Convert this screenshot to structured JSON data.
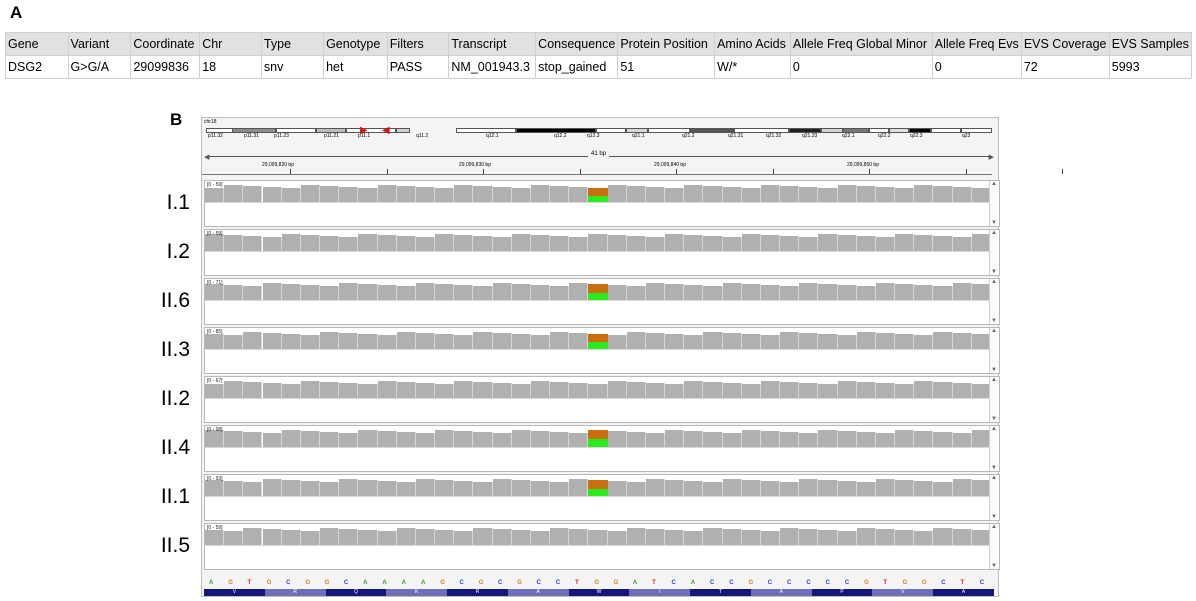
{
  "panel_a_label": "A",
  "panel_b_label": "B",
  "table": {
    "headers": [
      "Gene",
      "Variant",
      "Coordinate",
      "Chr",
      "Type",
      "Genotype",
      "Filters",
      "Transcript",
      "Consequence",
      "Protein Position",
      "Amino Acids",
      "Allele Freq Global Minor",
      "Allele Freq Evs",
      "EVS Coverage",
      "EVS Samples"
    ],
    "row": [
      "DSG2",
      "G>G/A",
      "29099836",
      "18",
      "snv",
      "het",
      "PASS",
      "NM_001943.3",
      "stop_gained",
      "51",
      "W/*",
      "0",
      "0",
      "72",
      "5993"
    ]
  },
  "igv": {
    "chromosome": "chr18",
    "bands": [
      "p11.32",
      "p11.31",
      "p11.23",
      "p11.21",
      "p11.1",
      "q11.2",
      "q12.1",
      "q12.2",
      "q12.3",
      "q21.1",
      "q21.2",
      "q21.31",
      "q21.32",
      "q21.33",
      "q22.1",
      "q22.2",
      "q22.3",
      "q23"
    ],
    "span_label": "41 bp",
    "ticks": [
      "29,099,820 bp",
      "29,099,830 bp",
      "29,099,840 bp",
      "29,099,850 bp"
    ],
    "sequence": [
      "A",
      "G",
      "T",
      "G",
      "C",
      "G",
      "G",
      "C",
      "A",
      "A",
      "A",
      "A",
      "G",
      "C",
      "G",
      "C",
      "G",
      "C",
      "C",
      "T",
      "G",
      "G",
      "A",
      "T",
      "C",
      "A",
      "C",
      "C",
      "G",
      "C",
      "C",
      "C",
      "C",
      "C",
      "G",
      "T",
      "G",
      "G",
      "C",
      "T",
      "C"
    ],
    "amino_acids": [
      "V",
      "R",
      "Q",
      "K",
      "R",
      "A",
      "W",
      "I",
      "T",
      "A",
      "P",
      "V",
      "A"
    ],
    "variant_column": 20
  },
  "samples": [
    {
      "label": "I.1",
      "range": "[0 - 59]",
      "variant": true
    },
    {
      "label": "I.2",
      "range": "[0 - 59]",
      "variant": false
    },
    {
      "label": "II.6",
      "range": "[0 - 71]",
      "variant": true
    },
    {
      "label": "II.3",
      "range": "[0 - 85]",
      "variant": true
    },
    {
      "label": "II.2",
      "range": "[0 - 67]",
      "variant": false
    },
    {
      "label": "II.4",
      "range": "[0 - 98]",
      "variant": true
    },
    {
      "label": "II.1",
      "range": "[0 - 93]",
      "variant": true
    },
    {
      "label": "II.5",
      "range": "[0 - 59]",
      "variant": false
    }
  ],
  "colors": {
    "coverage": "#b0b0b0",
    "alt_ref_allele": "#c8700f",
    "alt_alt_allele": "#2bea1d",
    "base_A": "#2e9e2e",
    "base_C": "#2a3fcf",
    "base_G": "#d3801b",
    "base_T": "#d42020",
    "aa_dark": "#14167a",
    "aa_light": "#6f6fb7"
  }
}
